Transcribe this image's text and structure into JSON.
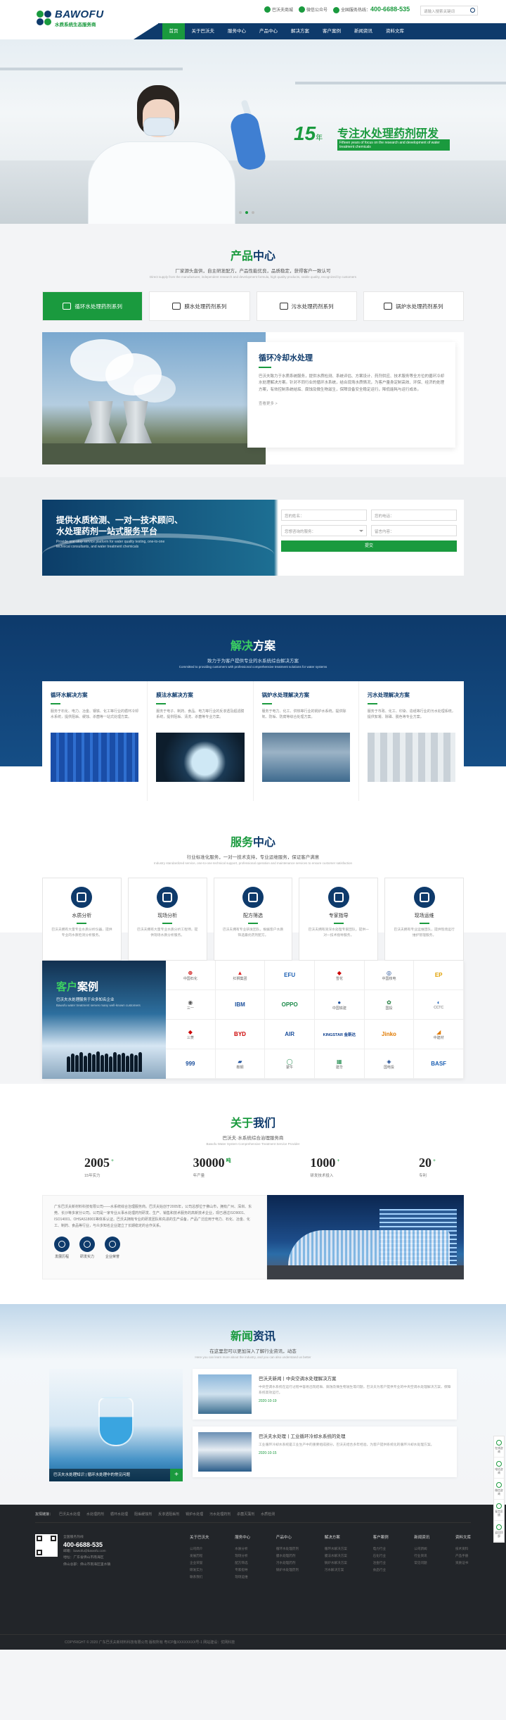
{
  "header": {
    "brand": "BAWOFU",
    "brand_sub": "水质系统生态服务商",
    "top_links": [
      "巴沃夫商城",
      "微信公众号",
      "全国服务热线："
    ],
    "phone": "400-6688-535",
    "search_placeholder": "请输入搜索关键词",
    "nav": [
      "首页",
      "关于巴沃夫",
      "服务中心",
      "产品中心",
      "解决方案",
      "客户案例",
      "新闻资讯",
      "资料文库"
    ]
  },
  "banner": {
    "years": "15",
    "years_unit": "年",
    "slogan": "专注水处理药剂研发",
    "slogan_en": "Fifteen years of focus on the research and development of water treatment chemicals"
  },
  "products": {
    "title_a": "产品",
    "title_b": "中心",
    "subtitle": "厂家源头直供，自主研发配方，产品性能优良，品质稳定，获得客户一致认可",
    "subtitle_en": "Direct supply from the manufacturer, independent research and development formula, high quality products, stable quality, recognized by customers",
    "tabs": [
      "循环水处理药剂系列",
      "膜水处理药剂系列",
      "污水处理药剂系列",
      "锅炉水处理药剂系列"
    ],
    "feature_title": "循环冷却水处理",
    "feature_desc": "巴沃夫致力于水质系统服务，提供水质检测、系统评估、方案设计、药剂供应、技术服务等全方位的循环冷却水处理解决方案。针对不同行业的循环水系统，结合现场水质情况，为客户量身定制高效、环保、经济的处理方案，有效控制系统结垢、腐蚀及微生物滋生，保障设备安全稳定运行，降低能耗与运行成本。",
    "more": "查看更多 >"
  },
  "consult": {
    "line1": "提供水质检测、一对一技术顾问、",
    "line2": "水处理药剂一站式服务平台",
    "en": "Provide one-stop service platform for water quality testing, one-to-one technical consultants, and water treatment chemicals",
    "name_ph": "您的姓名：",
    "phone_ph": "您的电话：",
    "select_ph": "您想咨询的服务：",
    "msg_ph": "留言内容：",
    "submit": "提交"
  },
  "solutions": {
    "title_a": "解决",
    "title_b": "方案",
    "subtitle": "致力于为客户提供专业的水系统综合解决方案",
    "subtitle_en": "Committed to providing customers with professional comprehensive treatment solutions for water systems",
    "cards": [
      {
        "title": "循环水解决方案",
        "desc": "服务于石化、电力、冶金、钢铁、化工等行业的循环冷却水系统，提供阻垢、缓蚀、杀菌等一站式处理方案。"
      },
      {
        "title": "膜法水解决方案",
        "desc": "服务于电子、制药、食品、电力等行业的反渗透及超滤膜系统，提供阻垢、清洗、杀菌等专业方案。"
      },
      {
        "title": "锅炉水处理解决方案",
        "desc": "服务于电力、化工、供热等行业的锅炉水系统，提供除氧、防垢、防腐等综合处理方案。"
      },
      {
        "title": "污水处理解决方案",
        "desc": "服务于市政、化工、印染、造纸等行业的污水处理系统，提供絮凝、除磷、脱色等专业方案。"
      }
    ]
  },
  "services": {
    "title_a": "服务",
    "title_b": "中心",
    "subtitle": "行业标准化服务，一对一技术支持，专业运维服务，保证客户满意",
    "subtitle_en": "Industry standardized service, one-to-one technical support, professional operation and maintenance services to ensure customer satisfaction",
    "items": [
      {
        "title": "水质分析",
        "desc": "巴沃夫拥有大量专业水质分析仪器，提供专业的水质检测分析服务。"
      },
      {
        "title": "现场分析",
        "desc": "巴沃夫拥有大量专业水质分析工程师，提供现场水质分析服务。"
      },
      {
        "title": "配方筛选",
        "desc": "巴沃夫拥有专业研发团队，根据客户水质筛选最优药剂配方。"
      },
      {
        "title": "专家指导",
        "desc": "巴沃夫拥有资深水处理专家团队，提供一对一技术指导服务。"
      },
      {
        "title": "现场运维",
        "desc": "巴沃夫拥有专业运维团队，提供现场运行维护管理服务。"
      }
    ]
  },
  "cases": {
    "title_a": "客户",
    "title_b": "案例",
    "subtitle": "巴沃夫水处理服务于众多知名企业",
    "subtitle_en": "Bawofu water treatment serves many well-known customers",
    "logos": [
      "中国石化",
      "红狮集团",
      "EFU",
      "雪花",
      "中国核电",
      "EP",
      "三一",
      "IBM",
      "OPPO",
      "中国铁建",
      "国投",
      "CCTC",
      "三菱",
      "BYD",
      "AIR",
      "KINGSTAR 金斯达",
      "Jinko",
      "中建材",
      "999",
      "鞍钢",
      "蒙牛",
      "建华",
      "国电投",
      "BASF"
    ]
  },
  "about": {
    "title_a": "关于",
    "title_b": "我们",
    "subtitle": "巴沃夫·水系统综合治理服务商",
    "subtitle_en": "Bawofu Water System Comprehensive Treatment Service Provider",
    "stats": [
      {
        "num": "2005",
        "unit": "+",
        "label": "15年实力"
      },
      {
        "num": "30000",
        "unit": "吨",
        "label": "年产量"
      },
      {
        "num": "1000",
        "unit": "+",
        "label": "研发技术投入"
      },
      {
        "num": "20",
        "unit": "+",
        "label": "专利"
      }
    ],
    "desc": "广东巴沃夫新材料科技有限公司——水系统综合治理服务商。巴沃夫始创于2005年，公司总部位于佛山市，拥有广州、深圳、东莞、长沙等多家分公司。公司是一家专业从事水处理药剂研发、生产、销售和技术服务的高新技术企业，现已通过ISO9001、ISO14001、OHSAS18001等体系认证。巴沃夫拥有专业的研发团队和先进的生产设备，产品广泛应用于电力、石化、冶金、化工、制药、食品等行业，与众多知名企业建立了长期稳定的合作关系。",
    "icons": [
      "发展历程",
      "研发实力",
      "企业荣誉"
    ]
  },
  "news": {
    "title_a": "新闻",
    "title_b": "资讯",
    "subtitle": "在这里您可以更加深入了解行业资讯，动态",
    "subtitle_en": "Here you can learn more about the industry, and you can also understand us better",
    "feature_caption": "巴沃夫水处理知识 | 循环水处理中的常见问题",
    "items": [
      {
        "title": "巴沃夫新闻丨中央空调水处理解决方案",
        "desc": "中央空调水系统在运行过程中容易出现结垢、腐蚀及微生物滋生等问题，巴沃夫为客户提供专业的中央空调水处理解决方案，保障系统高效运行。",
        "date": "2020-10-19"
      },
      {
        "title": "巴沃夫水处理丨工业循环冷却水系统的处理",
        "desc": "工业循环冷却水系统是工业生产中的重要组成部分，巴沃夫结合多年经验，为客户提供系统化的循环冷却水处理方案。",
        "date": "2020-10-15"
      }
    ]
  },
  "footer": {
    "links_label": "友情链接：",
    "links": [
      "巴沃夫水处理",
      "水处理药剂",
      "循环水处理",
      "阻垢缓蚀剂",
      "反渗透阻垢剂",
      "锅炉水处理",
      "污水处理药剂",
      "杀菌灭藻剂",
      "水质检测"
    ],
    "phone_label": "全国服务热线",
    "phone": "400-6688-535",
    "addr_lines": [
      "邮箱：bawofu@bawofu.com",
      "地址：广东省佛山市南海区",
      "佛山总部：佛山市南海区里水镇"
    ],
    "cols": [
      {
        "title": "关于巴沃夫",
        "items": [
          "公司简介",
          "发展历程",
          "企业荣誉",
          "研发实力",
          "联系我们"
        ]
      },
      {
        "title": "服务中心",
        "items": [
          "水质分析",
          "现场分析",
          "配方筛选",
          "专家指导",
          "现场运维"
        ]
      },
      {
        "title": "产品中心",
        "items": [
          "循环水处理药剂",
          "膜水处理药剂",
          "污水处理药剂",
          "锅炉水处理药剂"
        ]
      },
      {
        "title": "解决方案",
        "items": [
          "循环水解决方案",
          "膜法水解决方案",
          "锅炉水解决方案",
          "污水解决方案"
        ]
      },
      {
        "title": "客户案例",
        "items": [
          "电力行业",
          "石化行业",
          "冶金行业",
          "食品行业"
        ]
      },
      {
        "title": "新闻资讯",
        "items": [
          "公司新闻",
          "行业资讯",
          "常见问题"
        ]
      },
      {
        "title": "资料文库",
        "items": [
          "技术资料",
          "产品手册",
          "资质证书"
        ]
      }
    ],
    "copyright": "COPYRIGHT © 2020 广东巴沃夫新材料科技有限公司 版权所有 粤ICP备XXXXXXXX号-1 网站建设：优网科技"
  },
  "side": [
    "在线咨询",
    "电话咨询",
    "微信咨询",
    "留言反馈",
    "返回顶部"
  ]
}
